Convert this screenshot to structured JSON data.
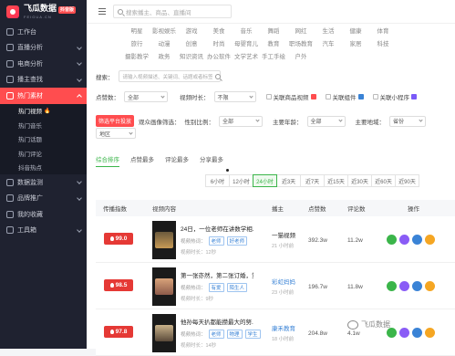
{
  "brand": {
    "name": "飞瓜数据",
    "sub": "FEIGUA.CN",
    "badge": "抖音版"
  },
  "sidebar": {
    "items": [
      {
        "label": "工作台",
        "icon": "home-icon"
      },
      {
        "label": "直播分析",
        "icon": "live-icon"
      },
      {
        "label": "电商分析",
        "icon": "cart-icon"
      },
      {
        "label": "播主查找",
        "icon": "user-search-icon"
      },
      {
        "label": "热门素材",
        "icon": "flame-icon"
      }
    ],
    "sub_items": [
      {
        "label": "热门视频",
        "flag": "🔥"
      },
      {
        "label": "热门音乐"
      },
      {
        "label": "热门话题"
      },
      {
        "label": "热门评论"
      },
      {
        "label": "抖音热点"
      }
    ],
    "items_bottom": [
      {
        "label": "数据监测",
        "icon": "monitor-icon"
      },
      {
        "label": "品牌推广",
        "icon": "brand-icon"
      },
      {
        "label": "我的收藏",
        "icon": "star-icon"
      },
      {
        "label": "工具箱",
        "icon": "toolbox-icon"
      }
    ]
  },
  "topbar": {
    "search_placeholder": "搜索播主、商品、直播间"
  },
  "categories": {
    "row1": [
      "明星",
      "影视娱乐",
      "游戏",
      "美食",
      "音乐",
      "舞蹈",
      "网红",
      "生活",
      "健康",
      "体育"
    ],
    "row2": [
      "旅行",
      "动漫",
      "创意",
      "时尚",
      "母婴育儿",
      "教育",
      "职场教育",
      "汽车",
      "家居",
      "科技"
    ],
    "row3": [
      "摄影教学",
      "政务",
      "知识资讯",
      "办公软件",
      "文学艺术",
      "手工手绘",
      "户外"
    ]
  },
  "filters": {
    "search_label": "搜索：",
    "search_placeholder": "请输入视频描述、关键词、话题或者标签",
    "likes_label": "点赞数：",
    "likes_value": "全部",
    "duration_label": "视频时长：",
    "duration_value": "不限",
    "related_goods": "关联商品视频",
    "related_component": "关联组件",
    "related_miniprogram": "关联小程序",
    "ad_tag": "筛选平台投放",
    "audience_label": "观众画像筛选：",
    "gender_label": "性别比例：",
    "gender_value": "全部",
    "age_label": "主要年龄：",
    "age_value": "全部",
    "region_label": "主要地域：",
    "region_value": "省份",
    "city_value": "地区"
  },
  "sort_tabs": [
    "综合排序",
    "点赞最多",
    "评论最多",
    "分享最多"
  ],
  "time_tabs": [
    "6小时",
    "12小时",
    "24小时",
    "近3天",
    "近7天",
    "近15天",
    "近30天",
    "近60天",
    "近90天"
  ],
  "table": {
    "headers": [
      "传播指数",
      "视频内容",
      "播主",
      "点赞数",
      "评论数",
      "操作"
    ],
    "rows": [
      {
        "score": "99.0",
        "title": "24日，一位老师在讲数学相...",
        "tags_label": "视频热词：",
        "tags": [
          "老师",
          "好老师"
        ],
        "duration": "视频时长：12秒",
        "author": "一猫视频",
        "ago": "21 小时前",
        "likes": "392.3w",
        "comments": "11.2w"
      },
      {
        "score": "98.5",
        "title": "第一张亦然，第二张订婚，第...",
        "tags_label": "视频热词：",
        "tags": [
          "有爱",
          "陌生人"
        ],
        "duration": "视频时长：9秒",
        "author": "彩虹妈妈",
        "ago": "23 小时前",
        "likes": "196.7w",
        "comments": "11.8w"
      },
      {
        "score": "97.8",
        "title": "他孙每天扒都能攒最大的努...",
        "tags_label": "视频热词：",
        "tags": [
          "老师",
          "物理",
          "学生"
        ],
        "duration": "视频时长：14秒",
        "author": "康禾教育",
        "ago": "18 小时前",
        "likes": "204.8w",
        "comments": "4.1w"
      }
    ]
  },
  "watermark": "飞瓜数据",
  "colors": {
    "accent": "#ff4d4f",
    "green": "#3bb54a",
    "sidebar": "#1f2230"
  }
}
